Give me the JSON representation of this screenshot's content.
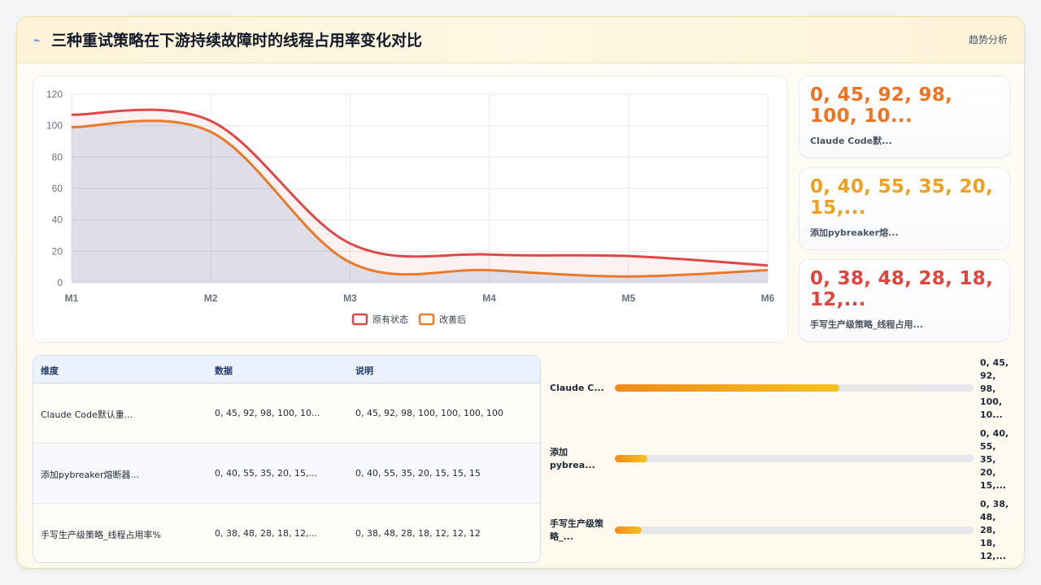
{
  "header": {
    "icon": "lightning-icon",
    "title": "三种重试策略在下游持续故障时的线程占用率变化对比",
    "action_label": "趋势分析"
  },
  "chart_data": {
    "type": "area",
    "categories": [
      "M1",
      "M2",
      "M3",
      "M4",
      "M5",
      "M6"
    ],
    "ylim": [
      0,
      120
    ],
    "yticks": [
      0,
      20,
      40,
      60,
      80,
      100,
      120
    ],
    "grid": true,
    "legend_position": "bottom-center",
    "series": [
      {
        "name": "原有状态",
        "color": "#e04848",
        "values": [
          107,
          103,
          25,
          18,
          17,
          11
        ]
      },
      {
        "name": "改善后",
        "color": "#e87a2a",
        "values": [
          99,
          96,
          13,
          8,
          4,
          8
        ]
      }
    ]
  },
  "kpis": [
    {
      "value": "0, 45, 92, 98, 100, 10...",
      "label": "Claude Code默...",
      "color": "#f07320"
    },
    {
      "value": "0, 40, 55, 35, 20, 15,...",
      "label": "添加pybreaker熔...",
      "color": "#f0a020"
    },
    {
      "value": "0, 38, 48, 28, 18, 12,...",
      "label": "手写生产级策略_线程占用...",
      "color": "#e0443c"
    }
  ],
  "table": {
    "headers": [
      "维度",
      "数据",
      "说明"
    ],
    "rows": [
      [
        "Claude Code默认重...",
        "0, 45, 92, 98, 100, 10...",
        "0, 45, 92, 98, 100, 100, 100, 100"
      ],
      [
        "添加pybreaker熔断器...",
        "0, 40, 55, 35, 20, 15,...",
        "0, 40, 55, 35, 20, 15, 15, 15"
      ],
      [
        "手写生产级策略_线程占用率%",
        "0, 38, 48, 28, 18, 12,...",
        "0, 38, 48, 28, 18, 12, 12, 12"
      ]
    ]
  },
  "bars": [
    {
      "label": "Claude C...",
      "value": "0, 45, 92, 98, 100, 10...",
      "fill_fraction": 0.625
    },
    {
      "label": "添加pybrea...",
      "value": "0, 40, 55, 35, 20, 15,...",
      "fill_fraction": 0.09
    },
    {
      "label": "手写生产级策略_...",
      "value": "0, 38, 48, 28, 18, 12,...",
      "fill_fraction": 0.075
    }
  ]
}
